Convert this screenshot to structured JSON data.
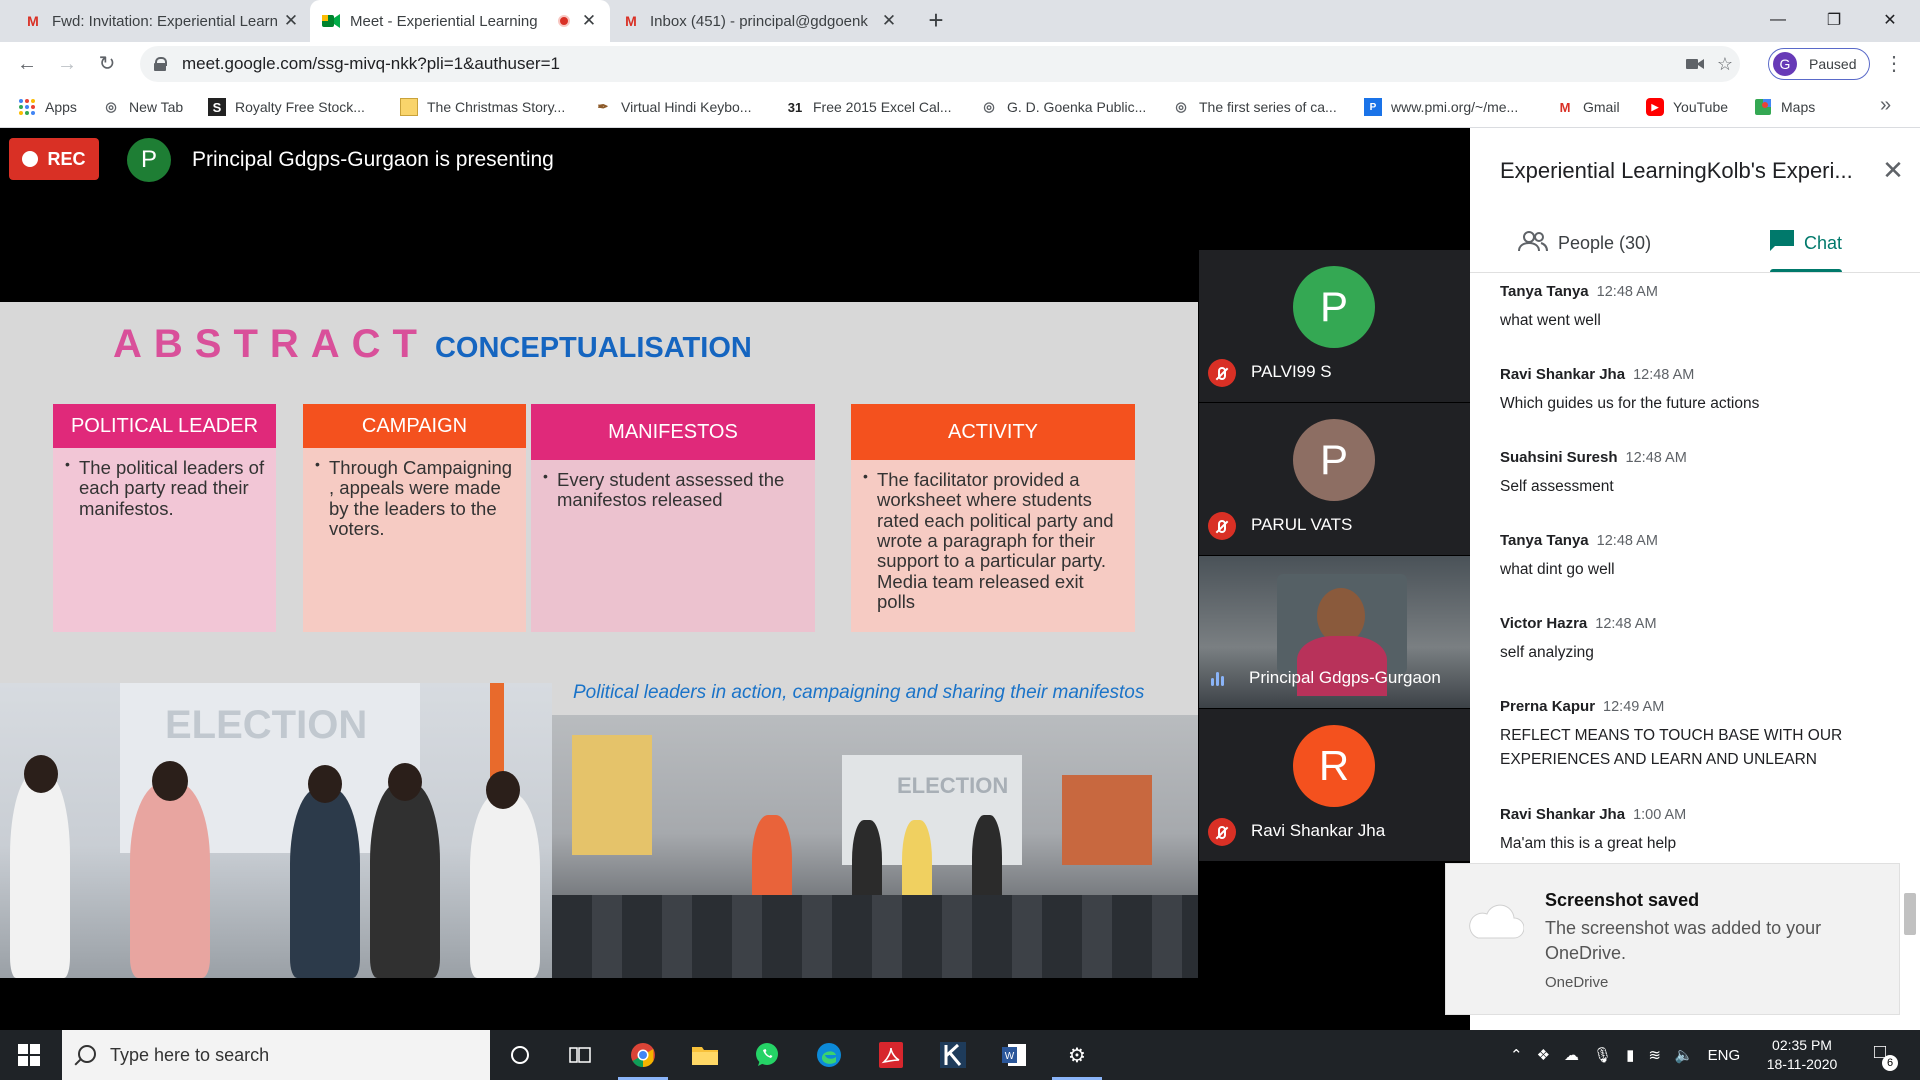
{
  "browser": {
    "tabs": [
      {
        "title": "Fwd: Invitation: Experiential Learn",
        "icon": "gmail-icon"
      },
      {
        "title": "Meet - Experiential Learning",
        "icon": "meet-icon",
        "active": true,
        "recording": true
      },
      {
        "title": "Inbox (451) - principal@gdgoenk",
        "icon": "gmail-icon"
      }
    ],
    "url": "meet.google.com/ssg-mivq-nkk?pli=1&authuser=1",
    "profile_initial": "G",
    "profile_status": "Paused",
    "bookmarks": [
      "Apps",
      "New Tab",
      "Royalty Free Stock...",
      "The Christmas Story...",
      "Virtual Hindi Keybo...",
      "Free 2015 Excel Cal...",
      "G. D. Goenka Public...",
      "The first series of ca...",
      "www.pmi.org/~/me...",
      "Gmail",
      "YouTube",
      "Maps"
    ]
  },
  "meet": {
    "rec_label": "REC",
    "presenter_initial": "P",
    "presenting_text": "Principal Gdgps-Gurgaon is presenting",
    "slide": {
      "title_main": "ABSTRACT",
      "title_sub": "CONCEPTUALISATION",
      "cards": [
        {
          "header": "POLITICAL LEADER",
          "body": "The political leaders of each party read their manifestos."
        },
        {
          "header": "CAMPAIGN",
          "body": "Through Campaigning , appeals were made by the leaders to the voters."
        },
        {
          "header": "MANIFESTOS",
          "body": "Every student assessed the manifestos released"
        },
        {
          "header": "ACTIVITY",
          "body": "The facilitator provided a worksheet where students rated each political party and  wrote a paragraph for their support to a particular party. Media team released exit polls"
        }
      ],
      "caption": "Political leaders in action, campaigning and sharing their manifestos",
      "photo_board_text": "ELECTION"
    },
    "participants": [
      {
        "initial": "P",
        "name": "PALVI99 S",
        "color": "#34a853",
        "muted": true
      },
      {
        "initial": "P",
        "name": "PARUL VATS",
        "color": "#8d6e63",
        "muted": true
      },
      {
        "initial": "",
        "name": "Principal Gdgps-Gurgaon",
        "video": true,
        "speaking": true
      },
      {
        "initial": "R",
        "name": "Ravi Shankar Jha",
        "color": "#f4511e",
        "muted": true
      }
    ]
  },
  "panel": {
    "title": "Experiential LearningKolb's Experi...",
    "people_tab": "People (30)",
    "chat_tab": "Chat",
    "messages": [
      {
        "sender": "Tanya Tanya",
        "time": "12:48 AM",
        "text": "what went well"
      },
      {
        "sender": "Ravi Shankar Jha",
        "time": "12:48 AM",
        "text": "Which guides us for the future actions"
      },
      {
        "sender": "Suahsini Suresh",
        "time": "12:48 AM",
        "text": "Self assessment"
      },
      {
        "sender": "Tanya Tanya",
        "time": "12:48 AM",
        "text": "what dint go well"
      },
      {
        "sender": "Victor Hazra",
        "time": "12:48 AM",
        "text": "self analyzing"
      },
      {
        "sender": "Prerna Kapur",
        "time": "12:49 AM",
        "text": "REFLECT MEANS TO TOUCH BASE WITH OUR EXPERIENCES AND LEARN AND UNLEARN"
      },
      {
        "sender": "Ravi Shankar Jha",
        "time": "1:00 AM",
        "text": "Ma'am this is a great help"
      }
    ]
  },
  "toast": {
    "title": "Screenshot saved",
    "body": "The screenshot was added to your OneDrive.",
    "source": "OneDrive"
  },
  "taskbar": {
    "search_placeholder": "Type here to search",
    "language": "ENG",
    "time": "02:35 PM",
    "date": "18-11-2020",
    "notification_count": "6"
  }
}
